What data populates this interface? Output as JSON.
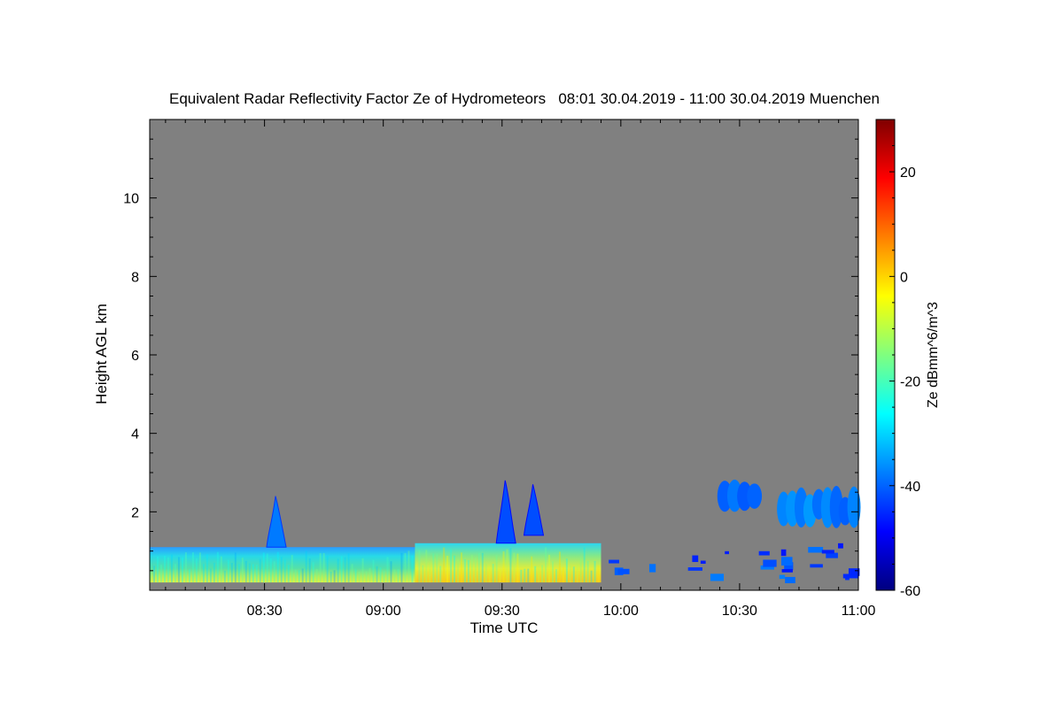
{
  "chart_data": {
    "type": "heatmap",
    "title": "Equivalent Radar Reflectivity Factor Ze of Hydrometeors   08:01 30.04.2019 - 11:00 30.04.2019 Muenchen",
    "xlabel": "Time UTC",
    "ylabel": "Height AGL km",
    "x_start": "08:01",
    "x_end": "11:00",
    "x_ticks": [
      "08:30",
      "09:00",
      "09:30",
      "10:00",
      "10:30",
      "11:00"
    ],
    "y_ticks": [
      "2",
      "4",
      "6",
      "8",
      "10"
    ],
    "ylim": [
      0,
      12
    ],
    "colorbar": {
      "label": "Ze dBmm^6/m^3",
      "ticks": [
        "20",
        "0",
        "-20",
        "-40",
        "-60"
      ],
      "range": [
        -60,
        30
      ],
      "colormap": "jet"
    },
    "background_color": "#808080",
    "features": [
      {
        "kind": "low-layer",
        "t_start": "08:01",
        "t_end": "09:08",
        "h_bottom_km": 0.2,
        "h_top_km": 1.1,
        "ze_dbz": [
          -35,
          -15
        ]
      },
      {
        "kind": "low-layer",
        "t_start": "09:08",
        "t_end": "09:55",
        "h_bottom_km": 0.2,
        "h_top_km": 1.2,
        "ze_dbz": [
          -30,
          0
        ]
      },
      {
        "kind": "plume",
        "t_center": "08:33",
        "h_bottom_km": 1.1,
        "h_top_km": 2.4,
        "ze_dbz": -38
      },
      {
        "kind": "plume",
        "t_center": "09:31",
        "h_bottom_km": 1.2,
        "h_top_km": 2.8,
        "ze_dbz": -42
      },
      {
        "kind": "plume",
        "t_center": "09:38",
        "h_bottom_km": 1.4,
        "h_top_km": 2.7,
        "ze_dbz": -42
      },
      {
        "kind": "cloud",
        "t_start": "10:25",
        "t_end": "10:35",
        "h_bottom_km": 2.0,
        "h_top_km": 2.8,
        "ze_dbz": -40
      },
      {
        "kind": "cloud",
        "t_start": "10:40",
        "t_end": "11:00",
        "h_bottom_km": 1.6,
        "h_top_km": 2.6,
        "ze_dbz": -38
      },
      {
        "kind": "broken-layer",
        "t_start": "09:55",
        "t_end": "11:00",
        "h_bottom_km": 0.3,
        "h_top_km": 1.2,
        "ze_dbz": -42
      }
    ]
  }
}
